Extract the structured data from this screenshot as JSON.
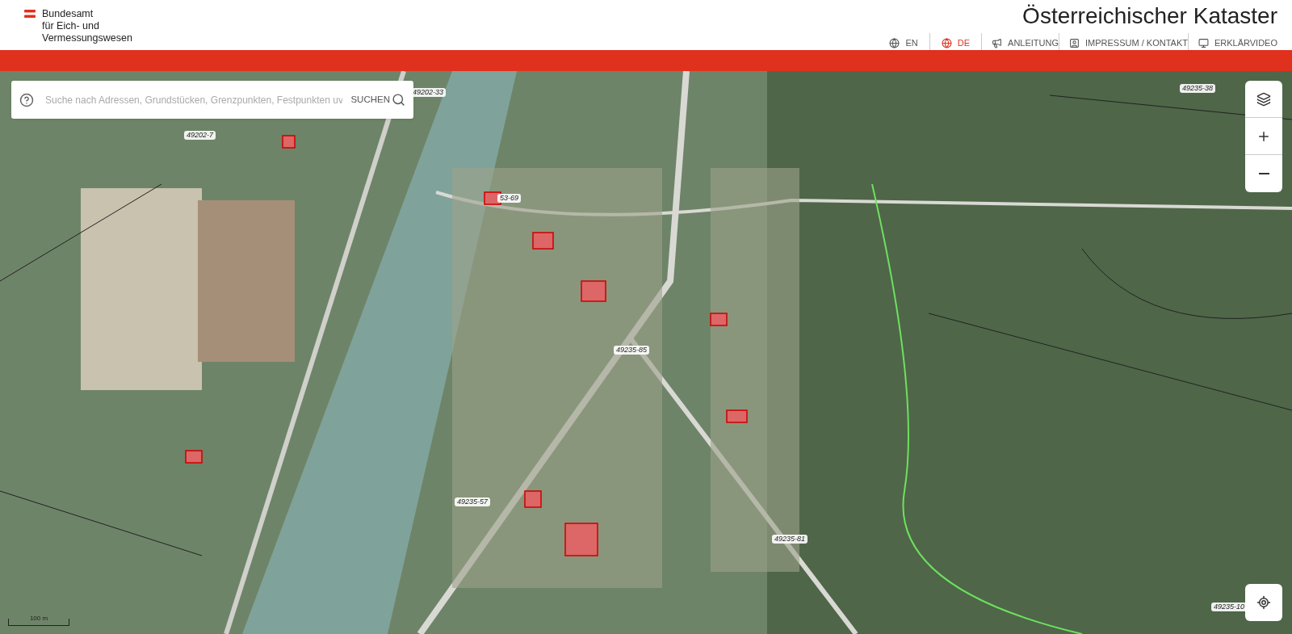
{
  "header": {
    "org_name": [
      "Bundesamt",
      "für Eich- und",
      "Vermessungswesen"
    ],
    "title": "Österreichischer Kataster",
    "languages": [
      {
        "label": "EN",
        "selected": false
      },
      {
        "label": "DE",
        "selected": true
      }
    ],
    "links": [
      {
        "kind": "megaphone",
        "label": "ANLEITUNG"
      },
      {
        "kind": "contact",
        "label": "IMPRESSUM / KONTAKT"
      },
      {
        "kind": "video",
        "label": "ERKLÄRVIDEO"
      }
    ]
  },
  "search": {
    "placeholder": "Suche nach Adressen, Grundstücken, Grenzpunkten, Festpunkten uv",
    "button": "SUCHEN"
  },
  "map": {
    "labels": [
      "49202-33",
      "49202-7",
      "53-69",
      "49235-85",
      "49235-57",
      "49235-81",
      "49235-38",
      "49235-10"
    ],
    "scale": "100 m"
  }
}
